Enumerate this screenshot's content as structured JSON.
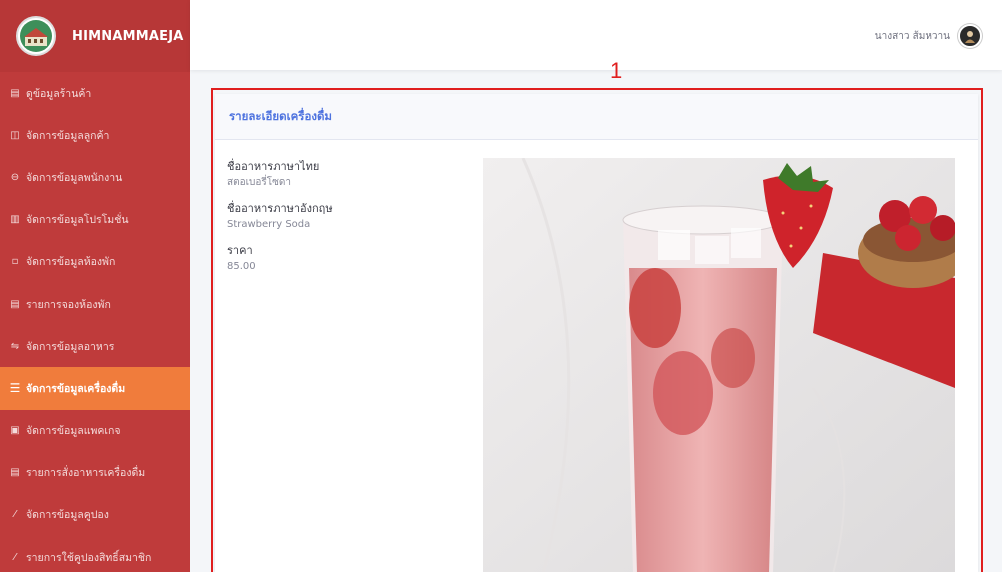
{
  "brand": {
    "name": "HIMNAMMAEJA"
  },
  "sidebar": {
    "items": [
      {
        "icon": "table-icon",
        "glyph": "▤",
        "label": "ดูข้อมูลร้านค้า",
        "active": false
      },
      {
        "icon": "users-icon",
        "glyph": "◫",
        "label": "จัดการข้อมูลลูกค้า",
        "active": false
      },
      {
        "icon": "car-icon",
        "glyph": "⊖",
        "label": "จัดการข้อมูลพนักงาน",
        "active": false
      },
      {
        "icon": "calendar-icon",
        "glyph": "▥",
        "label": "จัดการข้อมูลโปรโมชั่น",
        "active": false
      },
      {
        "icon": "bed-icon",
        "glyph": "▫",
        "label": "จัดการข้อมูลห้องพัก",
        "active": false
      },
      {
        "icon": "list-icon",
        "glyph": "▤",
        "label": "รายการจองห้องพัก",
        "active": false
      },
      {
        "icon": "food-icon",
        "glyph": "⇋",
        "label": "จัดการข้อมูลอาหาร",
        "active": false
      },
      {
        "icon": "drink-icon",
        "glyph": "☰",
        "label": "จัดการข้อมูลเครื่องดื่ม",
        "active": true
      },
      {
        "icon": "gift-icon",
        "glyph": "▣",
        "label": "จัดการข้อมูลแพคเกจ",
        "active": false
      },
      {
        "icon": "receipt-icon",
        "glyph": "▤",
        "label": "รายการสั่งอาหารเครื่องดื่ม",
        "active": false
      },
      {
        "icon": "pen-icon",
        "glyph": "⁄",
        "label": "จัดการข้อมูลคูปอง",
        "active": false
      },
      {
        "icon": "pen-icon",
        "glyph": "⁄",
        "label": "รายการใช้คูปองสิทธิ์สมาชิก",
        "active": false
      }
    ]
  },
  "topbar": {
    "user_name": "นางสาว ส้มหวาน"
  },
  "annotation": {
    "number": "1"
  },
  "card": {
    "title": "รายละเอียดเครื่องดื่ม",
    "fields": [
      {
        "label": "ชื่ออาหารภาษาไทย",
        "value": "สตอเบอรี่โซดา"
      },
      {
        "label": "ชื่ออาหารภาษาอังกฤษ",
        "value": "Strawberry Soda"
      },
      {
        "label": "ราคา",
        "value": "85.00"
      }
    ]
  },
  "colors": {
    "sidebar": "#bf3b3b",
    "active_item": "#f07c3c",
    "title_blue": "#4e73df",
    "highlight": "#e01e1e"
  }
}
